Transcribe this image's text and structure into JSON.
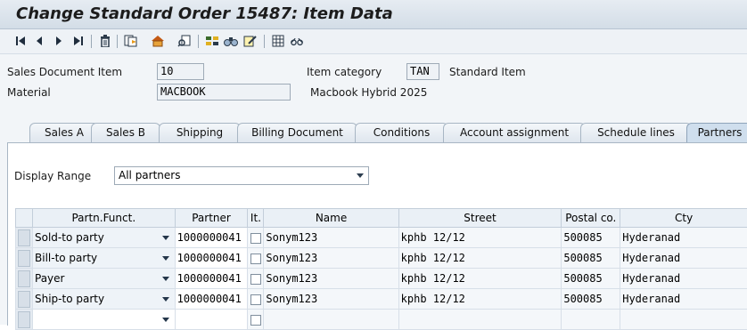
{
  "window": {
    "title": "Change Standard Order 15487: Item Data"
  },
  "toolbar": {
    "icons": [
      "first-page-icon",
      "previous-page-icon",
      "next-page-icon",
      "last-page-icon",
      "delete-icon",
      "copy-icon",
      "header-icon",
      "display-doc-icon",
      "configure-icon",
      "find-icon",
      "edit-icon",
      "calculator-icon",
      "glasses-icon"
    ]
  },
  "item": {
    "sales_document_item_label": "Sales Document Item",
    "sales_document_item_value": "10",
    "item_category_label": "Item category",
    "item_category_value": "TAN",
    "item_category_text": "Standard Item",
    "material_label": "Material",
    "material_value": "MACBOOK",
    "material_text": "Macbook Hybrid 2025"
  },
  "tabs": [
    {
      "label": "Sales A"
    },
    {
      "label": "Sales B"
    },
    {
      "label": "Shipping"
    },
    {
      "label": "Billing Document"
    },
    {
      "label": "Conditions"
    },
    {
      "label": "Account assignment"
    },
    {
      "label": "Schedule lines"
    },
    {
      "label": "Partners",
      "active": true
    }
  ],
  "partners": {
    "display_range_label": "Display Range",
    "display_range_value": "All partners",
    "columns": [
      "Partn.Funct.",
      "Partner",
      "It.",
      "Name",
      "Street",
      "Postal co.",
      "Cty"
    ],
    "rows": [
      {
        "function": "Sold-to party",
        "partner": "1000000041",
        "name": "Sonym123",
        "street": "kphb 12/12",
        "postal": "500085",
        "city": "Hyderanad"
      },
      {
        "function": "Bill-to party",
        "partner": "1000000041",
        "name": "Sonym123",
        "street": "kphb 12/12",
        "postal": "500085",
        "city": "Hyderanad"
      },
      {
        "function": "Payer",
        "partner": "1000000041",
        "name": "Sonym123",
        "street": "kphb 12/12",
        "postal": "500085",
        "city": "Hyderanad"
      },
      {
        "function": "Ship-to party",
        "partner": "1000000041",
        "name": "Sonym123",
        "street": "kphb 12/12",
        "postal": "500085",
        "city": "Hyderanad"
      },
      {
        "function": "",
        "partner": "",
        "name": "",
        "street": "",
        "postal": "",
        "city": ""
      }
    ]
  }
}
